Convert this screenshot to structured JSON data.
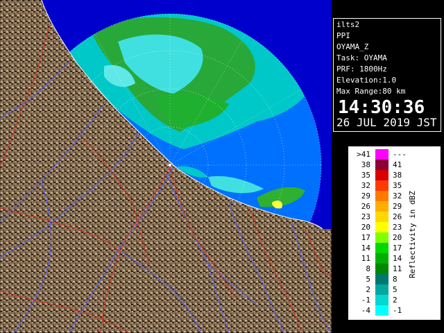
{
  "window": {
    "system": "ilts2",
    "product": "PPI",
    "field": "OYAMA_Z",
    "task": "Task: OYAMA",
    "prf": "PRF: 1800Hz",
    "elevation": "Elevation:1.0",
    "max_range": "Max Range:80 km",
    "time": "14:30:36",
    "date": "26 JUL 2019 JST"
  },
  "legend": {
    "title": "Reflectivity in dBZ",
    "rows": [
      {
        "lo": ">41",
        "hi": "---",
        "color": "#ff00ff"
      },
      {
        "lo": "38",
        "hi": "41",
        "color": "#8b0034"
      },
      {
        "lo": "35",
        "hi": "38",
        "color": "#d80000"
      },
      {
        "lo": "32",
        "hi": "35",
        "color": "#ff3a00"
      },
      {
        "lo": "29",
        "hi": "32",
        "color": "#ff7a00"
      },
      {
        "lo": "26",
        "hi": "29",
        "color": "#ffae00"
      },
      {
        "lo": "23",
        "hi": "26",
        "color": "#ffd800"
      },
      {
        "lo": "20",
        "hi": "23",
        "color": "#ffff00"
      },
      {
        "lo": "17",
        "hi": "20",
        "color": "#80ff00"
      },
      {
        "lo": "14",
        "hi": "17",
        "color": "#00d800"
      },
      {
        "lo": "11",
        "hi": "14",
        "color": "#00b000"
      },
      {
        "lo": "8",
        "hi": "11",
        "color": "#008800"
      },
      {
        "lo": "5",
        "hi": "8",
        "color": "#007870"
      },
      {
        "lo": "2",
        "hi": "5",
        "color": "#00a8a0"
      },
      {
        "lo": "-1",
        "hi": "2",
        "color": "#00d8d0"
      },
      {
        "lo": "-4",
        "hi": "-1",
        "color": "#00ffff"
      }
    ]
  },
  "colors": {
    "sea_outer": "#0000cc",
    "sea_inner": "#0070ff",
    "land": "#8a7055",
    "rivers": "#5060ff",
    "boundaries": "#d03020",
    "echo_weak": "#40e0e0",
    "echo_mid": "#30b030",
    "echo_strong": "#ffff40"
  }
}
